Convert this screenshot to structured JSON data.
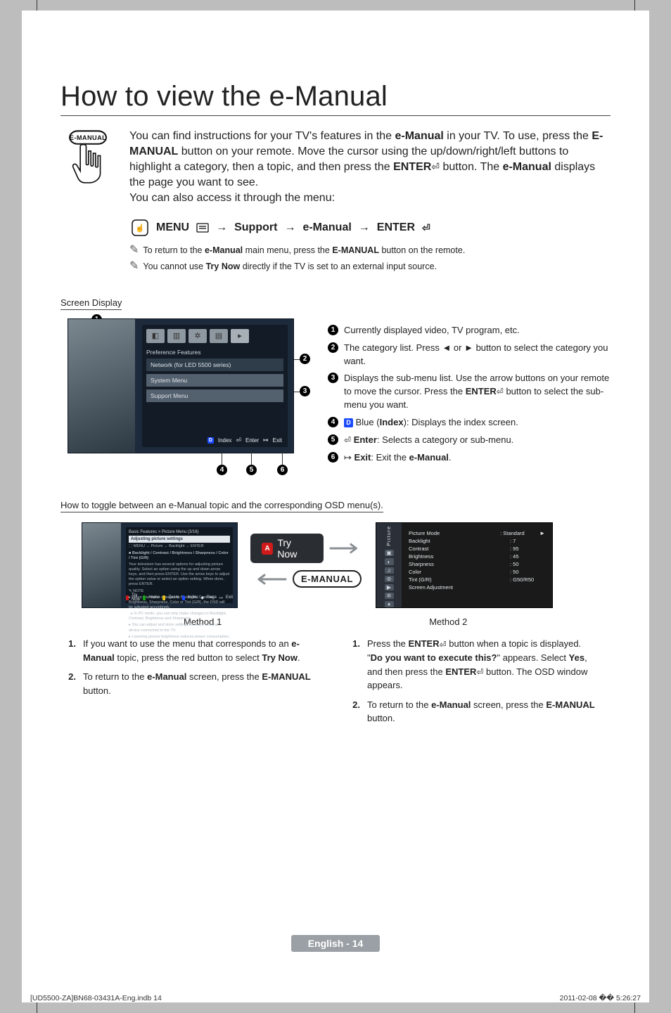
{
  "title": "How to view the e-Manual",
  "remote_label": "E-MANUAL",
  "intro": {
    "t1a": "You can find instructions for your TV's features in the ",
    "t1b": "e-Manual",
    "t1c": " in your TV. To use, press the ",
    "t1d": "E-MANUAL",
    "t1e": " button on your remote. Move the cursor using the up/down/right/left buttons to highlight a category, then a topic, and then press the ",
    "t1f": "ENTER",
    "t1g": " button. The ",
    "t1h": "e-Manual",
    "t1i": " displays the page you want to see.",
    "t2": "You can also access it through the menu:"
  },
  "path": {
    "menu": "MENU",
    "support": "Support",
    "emanual": "e-Manual",
    "enter": "ENTER",
    "arrow": "→"
  },
  "notes": {
    "n1a": "To return to the ",
    "n1b": "e-Manual",
    "n1c": " main menu, press the ",
    "n1d": "E-MANUAL",
    "n1e": " button on the remote.",
    "n2a": "You cannot use ",
    "n2b": "Try Now",
    "n2c": " directly if the TV is set to an external input source."
  },
  "screen_display": {
    "heading": "Screen Display",
    "tab_label": "Preference Features",
    "items": [
      "Network (for LED 5500 series)",
      "System Menu",
      "Support Menu"
    ],
    "footer": {
      "index": "Index",
      "enter": "Enter",
      "exit": "Exit",
      "d": "D"
    }
  },
  "callouts": {
    "c1": "Currently displayed video, TV program, etc.",
    "c2a": "The category list. Press ◄ or ► button to select the category you want.",
    "c3a": "Displays the sub-menu list. Use the arrow buttons on your remote to move the cursor. Press the ",
    "c3b": "ENTER",
    "c3c": " button to select the sub-menu you want.",
    "c4a": "Blue (",
    "c4b": "Index",
    "c4c": "): Displays the index screen.",
    "c4_chip": "D",
    "c5a": "Enter",
    "c5b": ": Selects a category or sub-menu.",
    "c6a": "Exit",
    "c6b": ": Exit the ",
    "c6c": "e-Manual",
    "c6d": "."
  },
  "toggle_heading": "How to toggle between an e-Manual topic and the corresponding OSD menu(s).",
  "m1_panel": {
    "breadcrumb": "Basic Features > Picture Menu (3/16)",
    "title": "Adjusting picture settings",
    "path": "MENU → Picture → Backlight → ENTER",
    "bold": "Backlight / Contrast / Brightness / Sharpness / Color / Tint (G/R)",
    "body1": "Your television has several options for adjusting picture quality. Select an option using the up and down arrow keys, and then press ENTER. Use the arrow keys to adjust the option value or select an option setting. When done, press ENTER.",
    "noteHead": "NOTE",
    "b1": "When you make changes to Backlight, Contrast, Brightness, Sharpness, Color or Tint (G/R), the OSD will be adjusted accordingly.",
    "b2": "In PC mode, you can only make changes to Backlight, Contrast, Brightness and Sharpness.",
    "b3": "You can adjust and store settings for each external device connected to the TV.",
    "b4": "Lowering picture brightness reduces power consumption.",
    "footer": [
      "Try Now",
      "Home",
      "Zoom",
      "Index",
      "Page",
      "Exit"
    ]
  },
  "try_now_badge": "Try Now",
  "try_now_a": "A",
  "emanual_badge": "E-MANUAL",
  "osd": {
    "side_label": "Picture",
    "rows": [
      {
        "k": "Picture Mode",
        "v": ": Standard",
        "arrow": "►"
      },
      {
        "k": "Backlight",
        "v": ": 7"
      },
      {
        "k": "Contrast",
        "v": ": 95"
      },
      {
        "k": "Brightness",
        "v": ": 45"
      },
      {
        "k": "Sharpness",
        "v": ": 50"
      },
      {
        "k": "Color",
        "v": ": 50"
      },
      {
        "k": "Tint (G/R)",
        "v": ": G50/R50"
      },
      {
        "k": "Screen Adjustment",
        "v": ""
      }
    ]
  },
  "method_labels": {
    "m1": "Method 1",
    "m2": "Method 2"
  },
  "steps_left": {
    "s1a": "If you want to use the menu that corresponds to an ",
    "s1b": "e-Manual",
    "s1c": " topic, press the red button to select ",
    "s1d": "Try Now",
    "s1e": ".",
    "s2a": "To return to the ",
    "s2b": "e-Manual",
    "s2c": " screen, press the ",
    "s2d": "E-MANUAL",
    "s2e": " button."
  },
  "steps_right": {
    "s1a": "Press the ",
    "s1b": "ENTER",
    "s1c": " button when a topic is displayed. \"",
    "s1d": "Do you want to execute this?",
    "s1e": "\" appears. Select ",
    "s1f": "Yes",
    "s1g": ", and then press the ",
    "s1h": "ENTER",
    "s1i": " button. The OSD window appears.",
    "s2a": "To return to the ",
    "s2b": "e-Manual",
    "s2c": " screen, press the ",
    "s2d": "E-MANUAL",
    "s2e": " button."
  },
  "page_footer": "English - 14",
  "footline_left": "[UD5500-ZA]BN68-03431A-Eng.indb   14",
  "footline_right": "2011-02-08   �� 5:26:27"
}
